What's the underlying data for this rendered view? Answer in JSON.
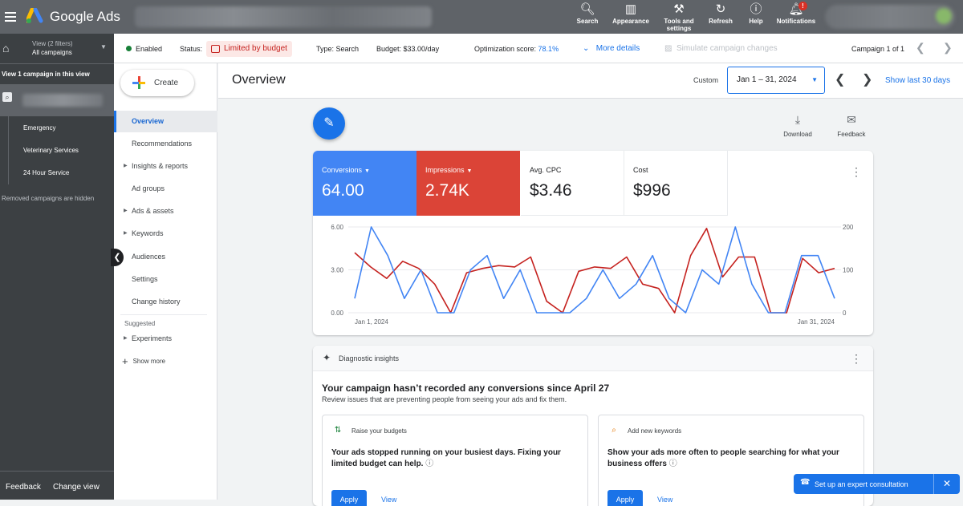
{
  "topbar": {
    "brand": "Google Ads",
    "tools": [
      {
        "label": "Search",
        "icon": "search-icon"
      },
      {
        "label": "Appearance",
        "icon": "appearance-icon"
      },
      {
        "label": "Tools and settings",
        "icon": "wrench-icon"
      },
      {
        "label": "Refresh",
        "icon": "refresh-icon"
      },
      {
        "label": "Help",
        "icon": "help-icon"
      },
      {
        "label": "Notifications",
        "icon": "bell-icon",
        "badge": "!"
      }
    ]
  },
  "leftnav": {
    "view_filters": "View (2 filters)",
    "view_name": "All campaigns",
    "campaign_count": "View 1 campaign in this view",
    "ad_groups": [
      "Emergency",
      "Veterinary Services",
      "24 Hour Service"
    ],
    "hidden_note": "Removed campaigns are hidden",
    "feedback": "Feedback",
    "change_view": "Change view"
  },
  "statusbar": {
    "enabled": "Enabled",
    "status_label": "Status:",
    "status_value": "Limited by budget",
    "type": "Type: Search",
    "budget": "Budget: $33.00/day",
    "opt_label": "Optimization score:",
    "opt_value": "78.1%",
    "more_details": "More details",
    "simulate": "Simulate campaign changes",
    "campaign_pager": "Campaign 1 of 1"
  },
  "sidenav": {
    "create": "Create",
    "items": [
      "Overview",
      "Recommendations",
      "Insights & reports",
      "Ad groups",
      "Ads & assets",
      "Keywords",
      "Audiences",
      "Settings",
      "Change history"
    ],
    "suggested": "Suggested",
    "experiments": "Experiments",
    "show_more": "Show more"
  },
  "main": {
    "title": "Overview",
    "custom": "Custom",
    "date_range": "Jan 1 – 31, 2024",
    "show_last": "Show last 30 days",
    "download": "Download",
    "feedback": "Feedback"
  },
  "metrics": [
    {
      "label": "Conversions",
      "value": "64.00",
      "color": "#4285f4"
    },
    {
      "label": "Impressions",
      "value": "2.74K",
      "color": "#db4437"
    },
    {
      "label": "Avg. CPC",
      "value": "$3.46"
    },
    {
      "label": "Cost",
      "value": "$996"
    }
  ],
  "chart_data": {
    "type": "line",
    "x_start_label": "Jan 1, 2024",
    "x_end_label": "Jan 31, 2024",
    "left_ticks": [
      "6.00",
      "3.00",
      "0.00"
    ],
    "right_ticks": [
      "200",
      "100",
      "0"
    ],
    "ylim_left": [
      0,
      6
    ],
    "ylim_right": [
      0,
      200
    ],
    "series": [
      {
        "name": "Conversions",
        "color": "#4285f4",
        "axis": "left",
        "values": [
          1,
          6,
          4,
          1,
          3,
          0,
          0,
          3,
          4,
          1,
          3,
          0,
          0,
          0,
          1,
          3,
          1,
          2,
          4,
          1,
          0,
          3,
          2,
          6,
          2,
          0,
          0,
          4,
          4,
          1
        ]
      },
      {
        "name": "Impressions",
        "color": "#c5221f",
        "axis": "left",
        "values": [
          4.2,
          3.2,
          2.4,
          3.6,
          3.1,
          2.0,
          0,
          2.8,
          3.1,
          3.3,
          3.2,
          3.9,
          0.8,
          0,
          2.9,
          3.2,
          3.1,
          3.9,
          2.0,
          1.7,
          0,
          4.0,
          5.9,
          2.5,
          3.9,
          3.9,
          0,
          0,
          3.8,
          2.8,
          3.1
        ]
      }
    ]
  },
  "diagnostics": {
    "title": "Diagnostic insights",
    "headline": "Your campaign hasn’t recorded any conversions since April 27",
    "sub": "Review issues that are preventing people from seeing your ads and fix them.",
    "cards": [
      {
        "title": "Raise your budgets",
        "body": "Your ads stopped running on your busiest days. Fixing your limited budget can help.",
        "apply": "Apply",
        "view": "View"
      },
      {
        "title": "Add new keywords",
        "body": "Show your ads more often to people searching for what your business offers",
        "apply": "Apply",
        "view": "View"
      }
    ]
  },
  "toast": {
    "label": "Set up an expert consultation"
  }
}
